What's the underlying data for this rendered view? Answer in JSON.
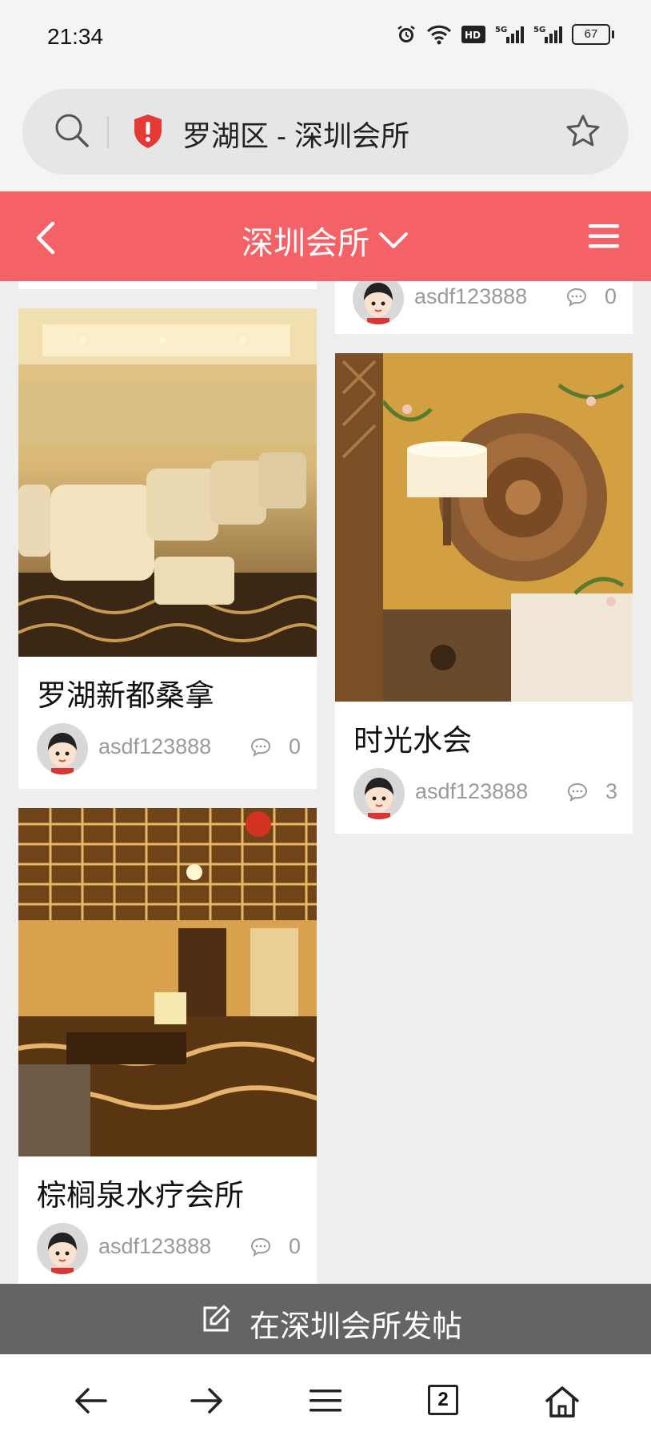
{
  "status": {
    "time": "21:34",
    "battery": "67"
  },
  "address": {
    "text": "罗湖区 - 深圳会所"
  },
  "header": {
    "title": "深圳会所"
  },
  "cards": [
    {
      "title": "罗湖新都桑拿",
      "author": "asdf123888",
      "comments": "0"
    },
    {
      "title": "棕榈泉水疗会所",
      "author": "asdf123888",
      "comments": "0"
    },
    {
      "title": "",
      "author": "asdf123888",
      "comments": "0"
    },
    {
      "title": "时光水会",
      "author": "asdf123888",
      "comments": "3"
    }
  ],
  "post_bar": {
    "label": "在深圳会所发帖"
  },
  "nav": {
    "tabs_count": "2"
  },
  "colors": {
    "header_bg": "#f46166",
    "post_bar_bg": "#646464",
    "shield": "#e53935"
  }
}
